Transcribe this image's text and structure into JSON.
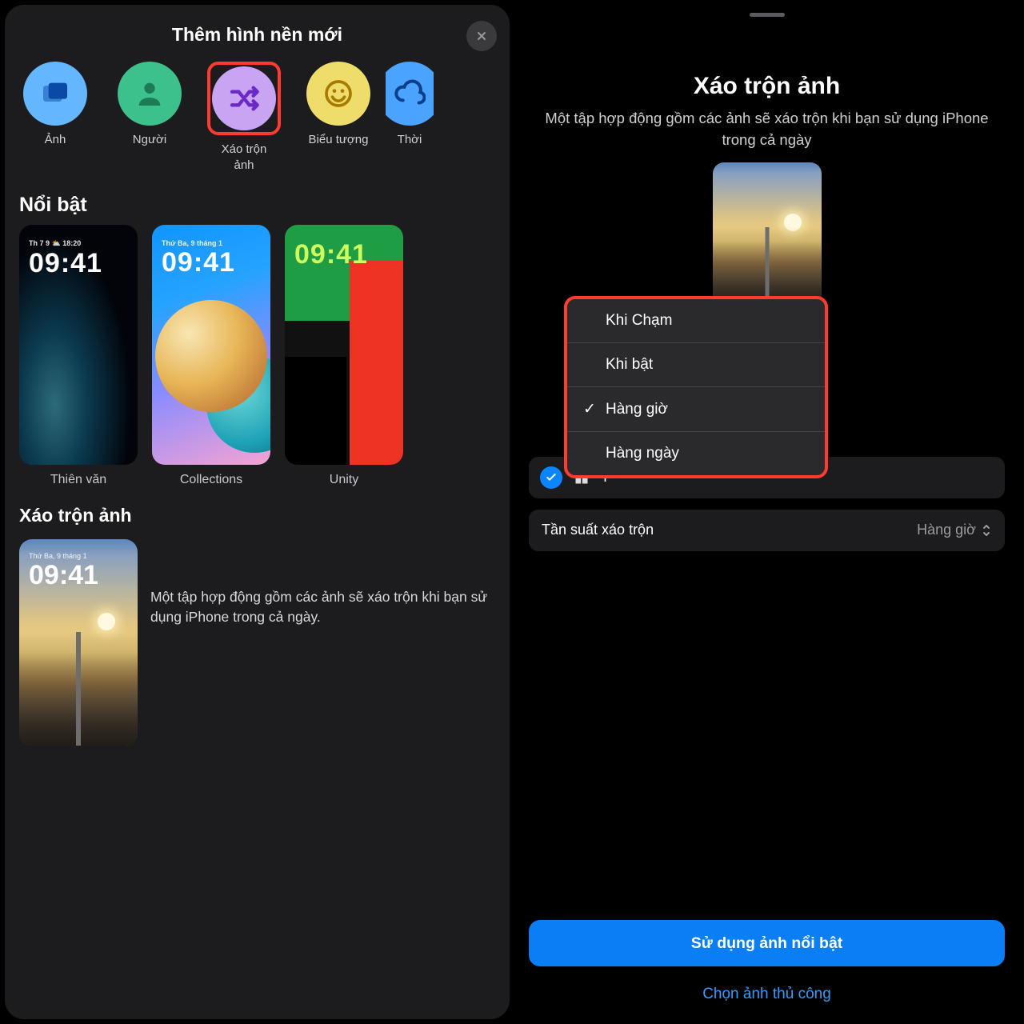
{
  "left": {
    "title": "Thêm hình nền mới",
    "categories": [
      {
        "label": "Ảnh",
        "icon": "photos-icon"
      },
      {
        "label": "Người",
        "icon": "person-icon"
      },
      {
        "label": "Xáo trộn\nảnh",
        "icon": "shuffle-icon",
        "highlighted": true
      },
      {
        "label": "Biểu tượng",
        "icon": "emoji-icon"
      },
      {
        "label": "Thời",
        "icon": "weather-icon"
      }
    ],
    "featured_heading": "Nổi bật",
    "featured": [
      {
        "label": "Thiên văn",
        "date": "Th 7 9 ⛅ 18:20",
        "time": "09:41"
      },
      {
        "label": "Collections",
        "date": "Thứ Ba, 9 tháng 1",
        "time": "09:41"
      },
      {
        "label": "Unity",
        "date": "",
        "time": "09:41"
      }
    ],
    "shuffle_heading": "Xáo trộn ảnh",
    "shuffle_preview": {
      "date": "Thứ Ba, 9 tháng 1",
      "time": "09:41"
    },
    "shuffle_description": "Một tập hợp động gồm các ảnh sẽ xáo trộn khi bạn sử dụng iPhone trong cả ngày."
  },
  "right": {
    "title": "Xáo trộn ảnh",
    "description": "Một tập hợp động gồm các ảnh sẽ xáo trộn khi bạn sử dụng iPhone trong cả ngày",
    "menu_items": [
      {
        "label": "Khi Chạm",
        "selected": false
      },
      {
        "label": "Khi bật",
        "selected": false
      },
      {
        "label": "Hàng giờ",
        "selected": true
      },
      {
        "label": "Hàng ngày",
        "selected": false
      }
    ],
    "pill_label": "T",
    "frequency_label": "Tần suất xáo trộn",
    "frequency_value": "Hàng giờ",
    "primary_button": "Sử dụng ảnh nổi bật",
    "secondary_link": "Chọn ảnh thủ công"
  }
}
